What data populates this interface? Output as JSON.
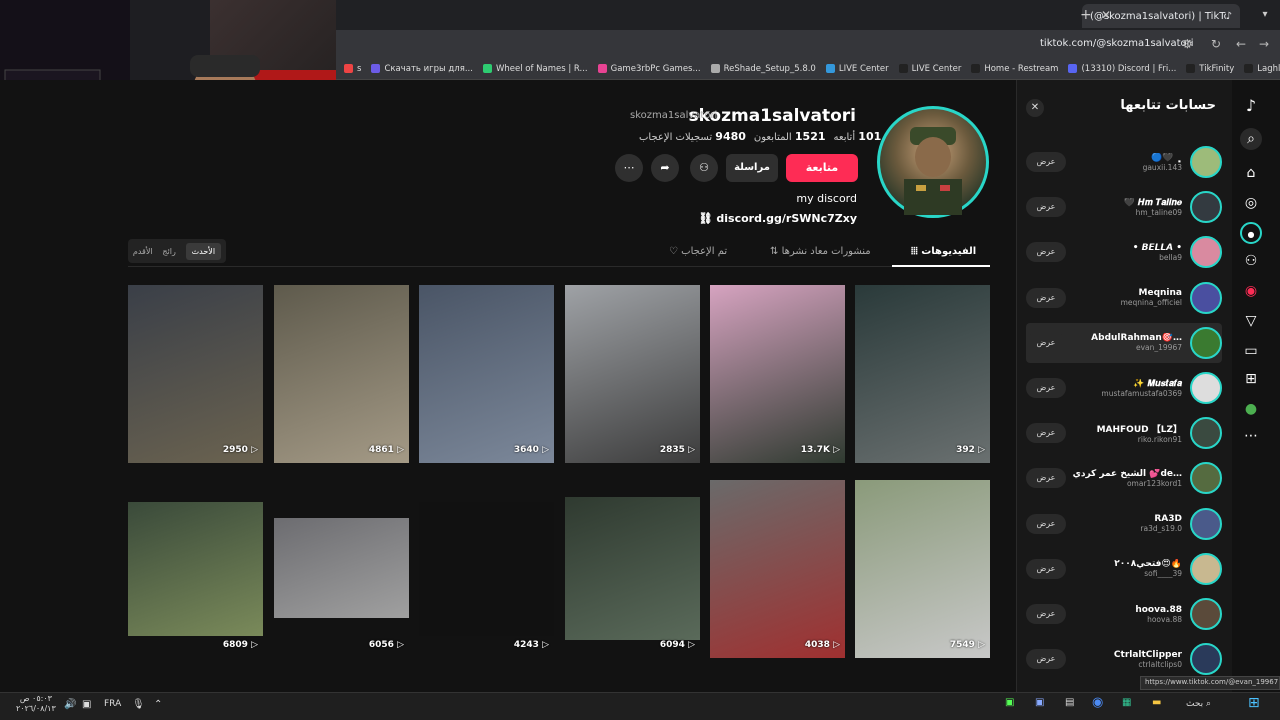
{
  "browser": {
    "tab_title": "(@skozma1salvatori) | TikTok",
    "url": "tiktok.com/@skozma1salvatori",
    "bookmarks": [
      {
        "label": "s",
        "color": "#e44"
      },
      {
        "label": "Скачать игры для...",
        "color": "#6c5ce7"
      },
      {
        "label": "Wheel of Names | R...",
        "color": "#2ecc71"
      },
      {
        "label": "Game3rbPc Games...",
        "color": "#e84393"
      },
      {
        "label": "ReShade_Setup_5.8.0",
        "color": "#aaa"
      },
      {
        "label": "LIVE Center",
        "color": "#3498db"
      },
      {
        "label": "LIVE Center",
        "color": "#222"
      },
      {
        "label": "Home - Restream",
        "color": "#222"
      },
      {
        "label": "(13310) Discord | Fri...",
        "color": "#5865f2"
      },
      {
        "label": "TikFinity",
        "color": "#222"
      },
      {
        "label": "Laghlid_Soufi (+99)",
        "color": "#222"
      }
    ]
  },
  "profile": {
    "username": "skozma1salvatori",
    "display_name": "skozma1salvatori",
    "following_count": "101",
    "following_label": "أتابعه",
    "followers_count": "1521",
    "followers_label": "المتابعون",
    "likes_count": "9480",
    "likes_label": "تسجيلات الإعجاب",
    "follow_label": "متابعة",
    "message_label": "مراسلة",
    "bio": "my discord",
    "link": "discord.gg/rSWNc7Zxy"
  },
  "sort": {
    "latest": "الأحدث",
    "popular": "رائج",
    "oldest": "الأقدم"
  },
  "tabs": {
    "videos": "الفيديوهات",
    "reposts": "منشورات معاد نشرها",
    "liked": "تم الإعجاب"
  },
  "videos": [
    {
      "views": "2950",
      "color1": "#3a3f48",
      "color2": "#6b6350"
    },
    {
      "views": "4861",
      "color1": "#5e5a4c",
      "color2": "#a49a86"
    },
    {
      "views": "3640",
      "color1": "#4a5566",
      "color2": "#7c889a"
    },
    {
      "views": "2835",
      "color1": "#9fa2a6",
      "color2": "#3c3c3c"
    },
    {
      "views": "13.7K",
      "color1": "#d6a3c0",
      "color2": "#2f3a30"
    },
    {
      "views": "392",
      "color1": "#2a3a3a",
      "color2": "#6a7070"
    },
    {
      "views": "6809",
      "color1": "#3a4a3a",
      "color2": "#7a8a5a"
    },
    {
      "views": "6056",
      "color1": "#6c6c70",
      "color2": "#a0a0a0"
    },
    {
      "views": "4243",
      "color1": "#111111",
      "color2": "#111111"
    },
    {
      "views": "6094",
      "color1": "#2f3a30",
      "color2": "#5a6a5a"
    },
    {
      "views": "4038",
      "color1": "#6a6a6a",
      "color2": "#a03030"
    },
    {
      "views": "7549",
      "color1": "#8a9a7a",
      "color2": "#c8c8c8"
    }
  ],
  "following_panel": {
    "title": "حسابات تتابعها",
    "view_label": "عرض",
    "accounts": [
      {
        "name": "🔵🖤 ﮼",
        "handle": "gauxii.143",
        "color": "#9dbb7a"
      },
      {
        "name": "🖤 𝑯𝒎 𝑻𝒂𝒍𝒊𝒏𝒆",
        "handle": "hm_taline09",
        "color": "#333a40"
      },
      {
        "name": "• 𝘽𝙀𝙇𝙇𝘼 •",
        "handle": "bella9",
        "color": "#d98aa0"
      },
      {
        "name": "Meqnina",
        "handle": "meqnina_officiel",
        "color": "#4a4fa0"
      },
      {
        "name": "AbdulRahman🎯…",
        "handle": "evan_19967",
        "color": "#3a7a30"
      },
      {
        "name": "✨ 𝑴𝒖𝒔𝒕𝒂𝒇𝒂",
        "handle": "mustafamustafa0369",
        "color": "#dddddd"
      },
      {
        "name": "MAHFOUD 【LZ】",
        "handle": "riko.rikon91",
        "color": "#3a4a40"
      },
      {
        "name": "الشيخ عمر كردي 💕de…",
        "handle": "omar123kord1",
        "color": "#556b40"
      },
      {
        "name": "RA3D",
        "handle": "ra3d_s19.0",
        "color": "#4a5a8a"
      },
      {
        "name": "فتحي٢٠٠٨😍🔥",
        "handle": "sofi____39",
        "color": "#c8b890"
      },
      {
        "name": "hoova.88",
        "handle": "hoova.88",
        "color": "#5a4a3a"
      },
      {
        "name": "CtrlaltClipper",
        "handle": "ctrlaltclips0",
        "color": "#2a3a5a"
      }
    ]
  },
  "status_tip": "https://www.tiktok.com/@evan_19967",
  "taskbar": {
    "lang": "FRA",
    "time": "٠٥:٠٣ ص",
    "date": "٢٠٢٦/٠٨/١٣",
    "search": "بحث"
  },
  "colors": {
    "accent": "#fe2c55",
    "avatar_ring": "#29d6c8"
  }
}
